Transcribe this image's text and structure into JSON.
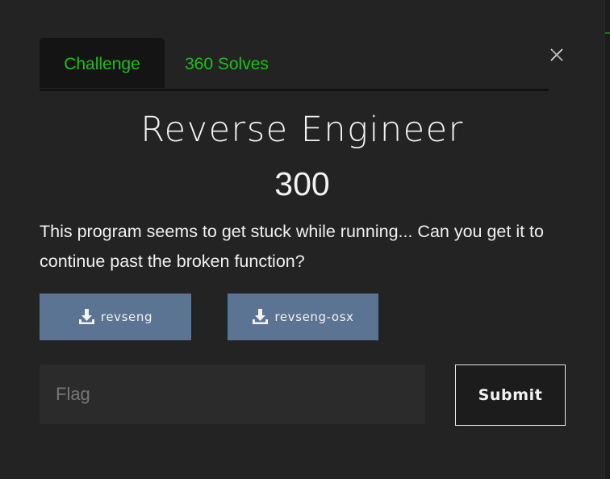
{
  "tabs": [
    {
      "label": "Challenge",
      "active": true
    },
    {
      "label": "360 Solves",
      "active": false
    }
  ],
  "challenge": {
    "name": "Reverse Engineer",
    "value": "300",
    "description": "This program seems to get stuck while running... Can you get it to continue past the broken function?"
  },
  "files": [
    {
      "label": "revseng",
      "icon": "download-icon"
    },
    {
      "label": "revseng-osx",
      "icon": "download-icon"
    }
  ],
  "flag_form": {
    "placeholder": "Flag",
    "value": "",
    "submit_label": "Submit"
  },
  "colors": {
    "accent_green": "#17c117",
    "file_button": "#5b7493",
    "background": "#232323"
  }
}
